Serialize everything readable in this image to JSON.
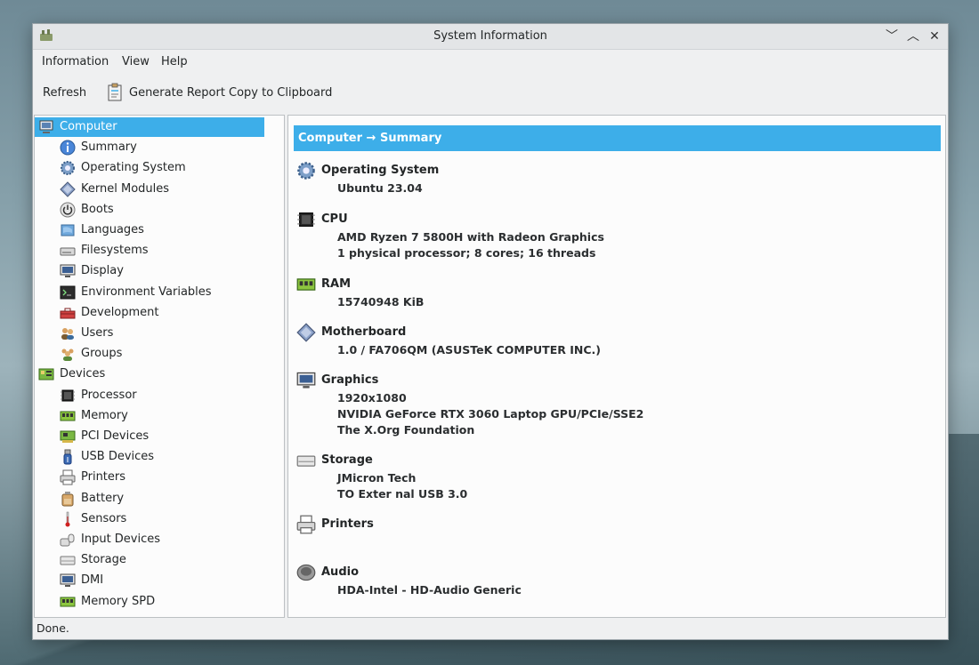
{
  "window": {
    "title": "System Information"
  },
  "menu": [
    "Information",
    "View",
    "Help"
  ],
  "toolbar": {
    "refresh": "Refresh",
    "generate_report": "Generate Report",
    "copy_clipboard": "Copy to Clipboard"
  },
  "sidebar": {
    "items": [
      {
        "label": "Computer",
        "icon": "computer-icon",
        "level": 0,
        "selected": true
      },
      {
        "label": "Summary",
        "icon": "info-icon",
        "level": 1
      },
      {
        "label": "Operating System",
        "icon": "gear-icon",
        "level": 1
      },
      {
        "label": "Kernel Modules",
        "icon": "diamond-icon",
        "level": 1
      },
      {
        "label": "Boots",
        "icon": "power-icon",
        "level": 1
      },
      {
        "label": "Languages",
        "icon": "flag-icon",
        "level": 1
      },
      {
        "label": "Filesystems",
        "icon": "drive-icon",
        "level": 1
      },
      {
        "label": "Display",
        "icon": "monitor-icon",
        "level": 1
      },
      {
        "label": "Environment Variables",
        "icon": "terminal-icon",
        "level": 1
      },
      {
        "label": "Development",
        "icon": "toolbox-icon",
        "level": 1
      },
      {
        "label": "Users",
        "icon": "users-icon",
        "level": 1
      },
      {
        "label": "Groups",
        "icon": "groups-icon",
        "level": 1
      },
      {
        "label": "Devices",
        "icon": "board-icon",
        "level": 0
      },
      {
        "label": "Processor",
        "icon": "chip-icon",
        "level": 1
      },
      {
        "label": "Memory",
        "icon": "ram-icon",
        "level": 1
      },
      {
        "label": "PCI Devices",
        "icon": "pci-icon",
        "level": 1
      },
      {
        "label": "USB Devices",
        "icon": "usb-icon",
        "level": 1
      },
      {
        "label": "Printers",
        "icon": "printer-icon",
        "level": 1
      },
      {
        "label": "Battery",
        "icon": "battery-icon",
        "level": 1
      },
      {
        "label": "Sensors",
        "icon": "thermometer-icon",
        "level": 1
      },
      {
        "label": "Input Devices",
        "icon": "input-icon",
        "level": 1
      },
      {
        "label": "Storage",
        "icon": "storage-icon",
        "level": 1
      },
      {
        "label": "DMI",
        "icon": "monitor-icon",
        "level": 1
      },
      {
        "label": "Memory SPD",
        "icon": "ram-icon",
        "level": 1
      }
    ]
  },
  "content": {
    "header": "Computer → Summary",
    "sections": [
      {
        "title": "Operating System",
        "icon": "gear-icon",
        "values": [
          "Ubuntu 23.04"
        ]
      },
      {
        "title": "CPU",
        "icon": "chip-icon",
        "values": [
          "AMD Ryzen 7 5800H with Radeon Graphics",
          "1 physical processor; 8 cores; 16 threads"
        ]
      },
      {
        "title": "RAM",
        "icon": "ram-icon",
        "values": [
          "15740948 KiB"
        ]
      },
      {
        "title": "Motherboard",
        "icon": "diamond-icon",
        "values": [
          "1.0 / FA706QM (ASUSTeK COMPUTER INC.)"
        ]
      },
      {
        "title": "Graphics",
        "icon": "monitor-icon",
        "values": [
          "1920x1080",
          "NVIDIA GeForce RTX 3060 Laptop GPU/PCIe/SSE2",
          "The X.Org Foundation"
        ]
      },
      {
        "title": "Storage",
        "icon": "storage-icon",
        "values": [
          "JMicron Tech",
          "TO Exter nal USB 3.0"
        ]
      },
      {
        "title": "Printers",
        "icon": "printer-icon",
        "values": []
      },
      {
        "title": "Audio",
        "icon": "speaker-icon",
        "values": [
          "HDA-Intel - HD-Audio Generic"
        ]
      }
    ]
  },
  "status": "Done."
}
